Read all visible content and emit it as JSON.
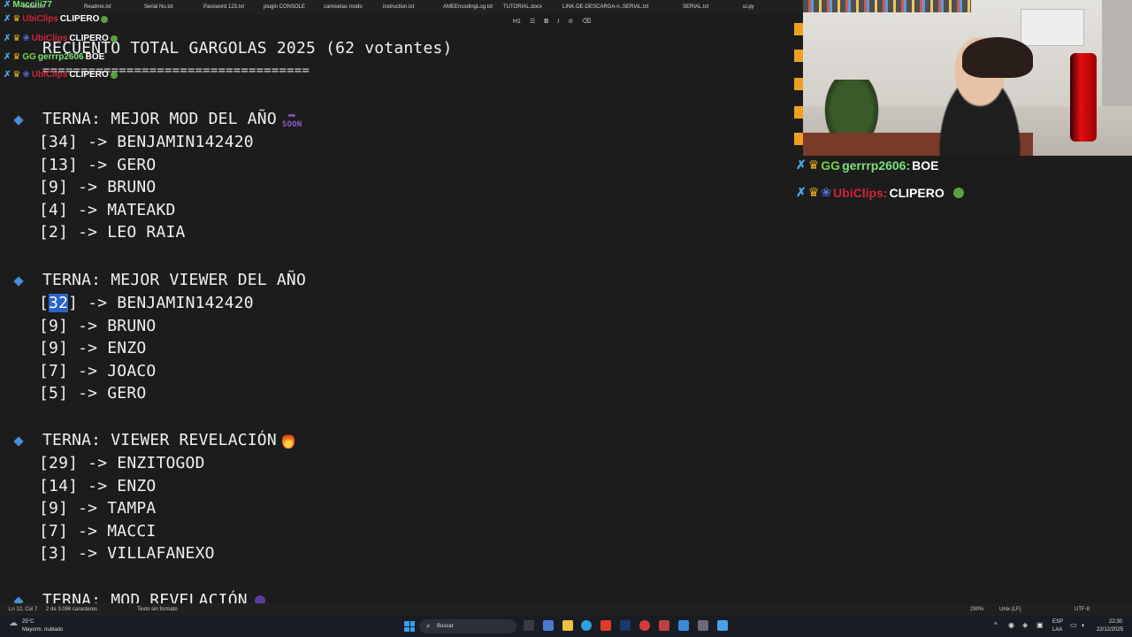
{
  "tabs": [
    "install.txt",
    "Readme.txt",
    "Serial No.txt",
    "Password 123.txt",
    "plugin CONSOLE",
    "camisetas modo",
    "instruction.txt",
    "AMEEncodingLog.txt",
    "TUTORIAL.docx",
    "LINK-DE-DESCARGA-n...",
    "SERIAL.txt",
    "SERIAL.txt",
    "ui.py"
  ],
  "toolbar": [
    "H1",
    "☰",
    "B",
    "I",
    "⊘",
    "⌫"
  ],
  "doc": {
    "title": "RECUENTO TOTAL GARGOLAS 2025 (62 votantes)",
    "rule": "===================================",
    "sections": [
      {
        "heading": "TERNA: MEJOR MOD DEL AÑO",
        "emoji": "SOON",
        "items": [
          "[34] -> BENJAMIN142420",
          "[13] -> GERO",
          "[9] -> BRUNO",
          "[4] -> MATEAKD",
          "[2] -> LEO RAIA"
        ]
      },
      {
        "heading": "TERNA: MEJOR VIEWER DEL AÑO",
        "items": [
          "[32] -> BENJAMIN142420",
          "[9] -> BRUNO",
          "[9] -> ENZO",
          "[7] -> JOACO",
          "[5] -> GERO"
        ],
        "first_item": {
          "open": "[",
          "selected": "32",
          "rest": "] -> BENJAMIN142420"
        }
      },
      {
        "heading": "TERNA: VIEWER REVELACIÓN",
        "items": [
          "[29] -> ENZITOGOD",
          "[14] -> ENZO",
          "[9] -> TAMPA",
          "[7] -> MACCI",
          "[3] -> VILLAFANEXO"
        ]
      },
      {
        "heading": "TERNA: MOD REVELACIÓN"
      }
    ]
  },
  "chat_overlay": [
    {
      "user": "Macciii77",
      "message": ""
    },
    {
      "user": "UbiClips",
      "message": "CLIPERO"
    },
    {
      "user": "UbiClips",
      "message": "CLIPERO"
    },
    {
      "user": "gerrrp2606",
      "message": "BOE"
    },
    {
      "user": "UbiClips",
      "message": "CLIPERO"
    }
  ],
  "chat_right": [
    {
      "user": "gerrrp2606:",
      "message": "BOE"
    },
    {
      "user": "UbiClips:",
      "message": "CLIPERO"
    }
  ],
  "status_bar": {
    "position": "Ln 12, Col 7",
    "chars": "2 de 3.096 caracteres",
    "format": "Texto sin formato",
    "zoom": "290%",
    "eol": "Unix (LF)",
    "encoding": "UTF-8"
  },
  "taskbar": {
    "weather_temp": "25°C",
    "weather_desc": "Mayorm. nublado",
    "search_placeholder": "Buscar",
    "lang": "ESP",
    "lang2": "LAA",
    "time": "22:30",
    "date": "22/12/2025"
  },
  "colors": {
    "selection": "#2a64c8",
    "bullet": "#4a8cd6",
    "mod_badge": "#4aa8e8",
    "user_red": "#d0243a",
    "user_green": "#7ee07a"
  }
}
